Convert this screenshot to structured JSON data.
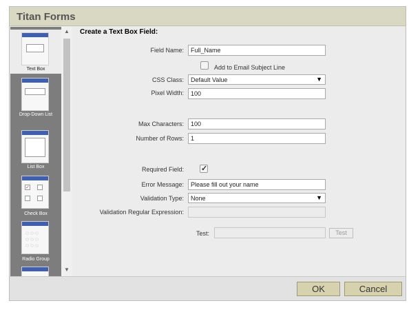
{
  "window": {
    "title": "Titan Forms"
  },
  "sidebar": {
    "items": [
      {
        "label": "Text Box",
        "selected": true
      },
      {
        "label": "Drop-Down List",
        "selected": false
      },
      {
        "label": "List Box",
        "selected": false
      },
      {
        "label": "Check Box",
        "selected": false
      },
      {
        "label": "Radio Group",
        "selected": false
      },
      {
        "label": "",
        "selected": false
      }
    ]
  },
  "form": {
    "heading": "Create a Text Box Field:",
    "field_name": {
      "label": "Field Name:",
      "value": "Full_Name"
    },
    "email_subject": {
      "label": "Add to Email Subject Line",
      "checked": false
    },
    "css_class": {
      "label": "CSS Class:",
      "value": "Default Value"
    },
    "pixel_width": {
      "label": "Pixel Width:",
      "value": "100"
    },
    "max_characters": {
      "label": "Max Characters:",
      "value": "100"
    },
    "number_of_rows": {
      "label": "Number of Rows:",
      "value": "1"
    },
    "required_field": {
      "label": "Required Field:",
      "checked": true
    },
    "error_message": {
      "label": "Error Message:",
      "value": "Please fill out your name"
    },
    "validation_type": {
      "label": "Validation Type:",
      "value": "None"
    },
    "validation_regex": {
      "label": "Validation Regular Expression:",
      "value": ""
    },
    "test": {
      "label": "Test:",
      "value": "",
      "button_label": "Test"
    }
  },
  "footer": {
    "ok_label": "OK",
    "cancel_label": "Cancel"
  },
  "colors": {
    "titlebar": "#d9d8c2",
    "sidebar": "#7d7d7d",
    "button": "#d6d2ad"
  }
}
